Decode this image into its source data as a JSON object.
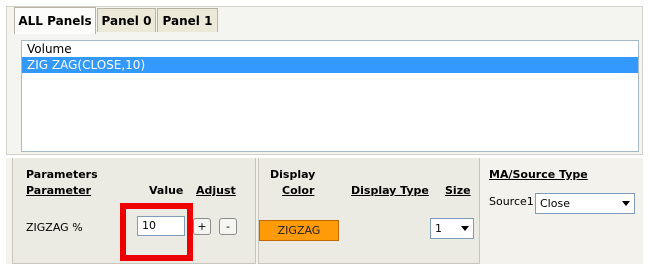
{
  "tabs": [
    {
      "label": "ALL Panels"
    },
    {
      "label": "Panel 0"
    },
    {
      "label": "Panel 1"
    }
  ],
  "panel_list": {
    "items": [
      {
        "label": "Volume",
        "selected": false
      },
      {
        "label": "ZIG ZAG(CLOSE,10)",
        "selected": true
      }
    ]
  },
  "parameters": {
    "section_title": "Parameters",
    "col_parameter": "Parameter",
    "col_value": "Value",
    "col_adjust": "Adjust",
    "row": {
      "name": "ZIGZAG %",
      "value": "10",
      "increment_label": "+",
      "decrement_label": "-"
    }
  },
  "display": {
    "section_title": "Display",
    "col_color": "Color",
    "col_display_type": "Display Type",
    "col_size": "Size",
    "color_label": "ZIGZAG",
    "color_hex": "#ff9a08",
    "size_value": "1"
  },
  "ma_source": {
    "section_title": "MA/Source Type",
    "source_label": "Source1",
    "source_value": "Close"
  }
}
